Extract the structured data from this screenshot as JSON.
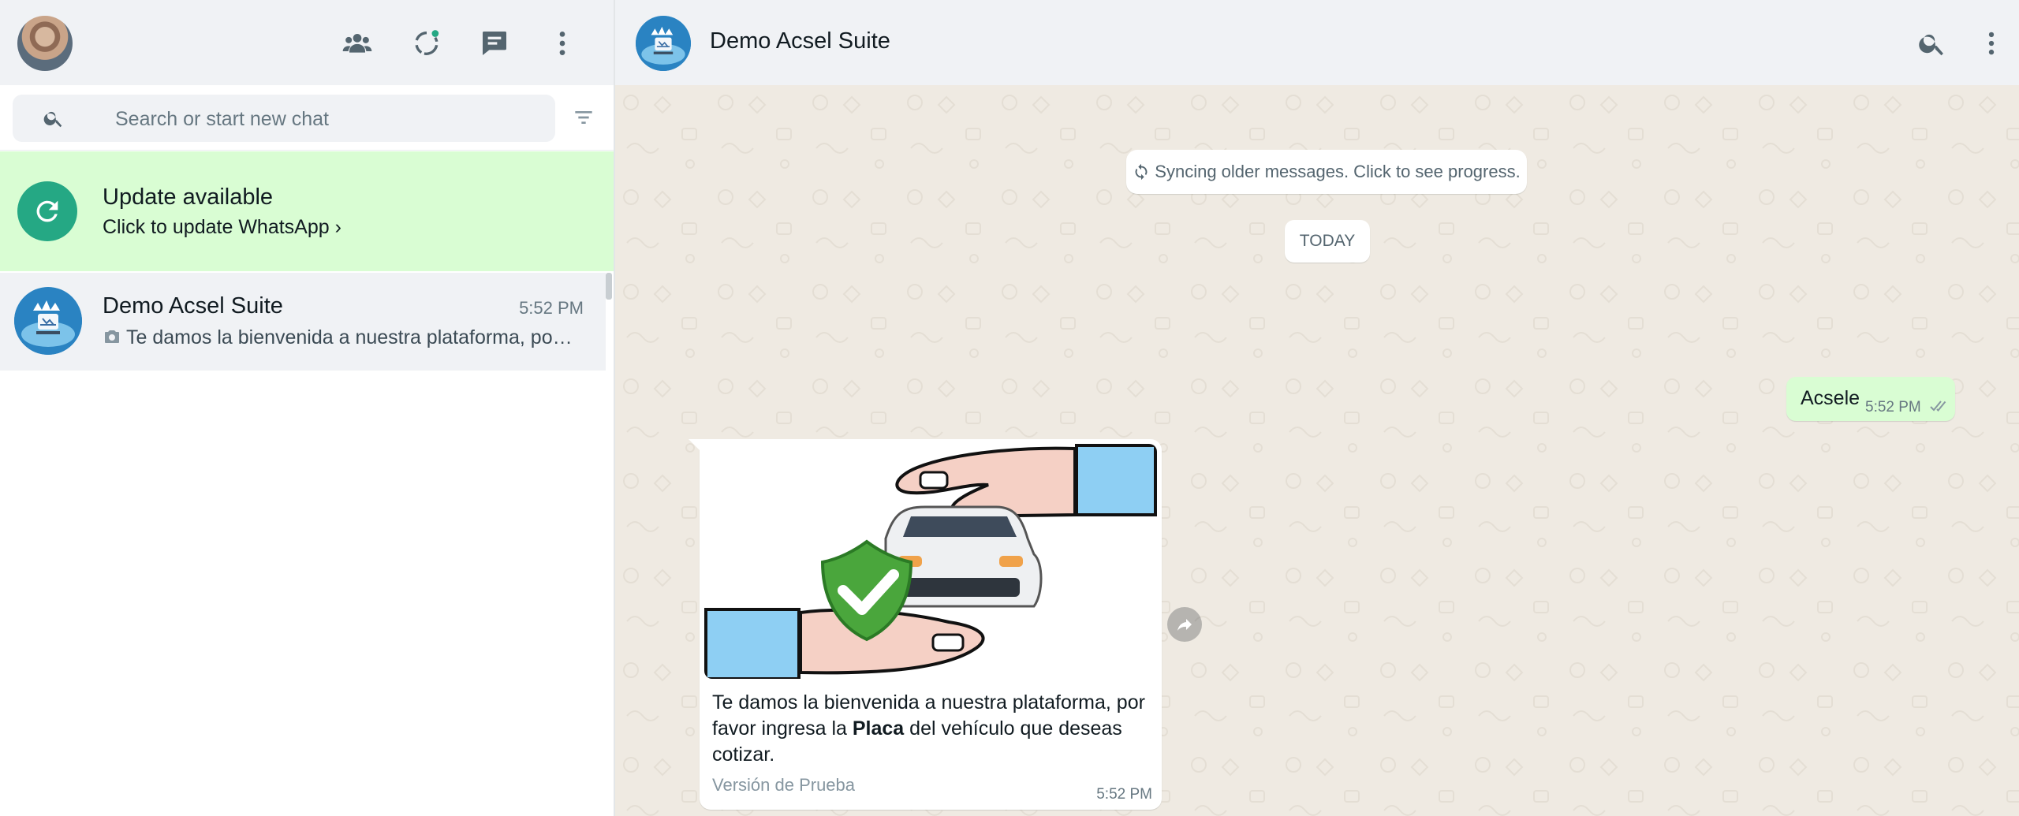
{
  "sidebar": {
    "header": {
      "profile_avatar": "user-photo",
      "icons": [
        "communities-icon",
        "status-icon",
        "new-chat-icon",
        "menu-icon"
      ]
    },
    "search": {
      "placeholder": "Search or start new chat",
      "value": ""
    },
    "update_banner": {
      "title": "Update available",
      "subtitle": "Click to update WhatsApp ›"
    },
    "chats": [
      {
        "name": "Demo Acsel Suite",
        "time": "5:52 PM",
        "preview": "Te damos la bienvenida a nuestra plataforma, por f..."
      }
    ]
  },
  "conversation": {
    "contact_name": "Demo Acsel Suite",
    "sync_notice": "Syncing older messages. Click to see progress.",
    "date_divider": "TODAY",
    "messages": [
      {
        "direction": "outgoing",
        "text": "Acsele",
        "time": "5:52 PM",
        "status": "delivered"
      },
      {
        "direction": "incoming",
        "type": "image",
        "caption_before": "Te damos la bienvenida a nuestra plataforma, por favor ingresa la ",
        "caption_bold": "Placa",
        "caption_after": " del vehículo que deseas cotizar.",
        "footer": "Versión de Prueba",
        "time": "5:52 PM"
      }
    ]
  },
  "colors": {
    "header_bg": "#f0f2f5",
    "chat_bg": "#efeae2",
    "outgoing_bubble": "#d9fdd3",
    "banner_bg": "#d9fdd3",
    "accent": "#25a884"
  }
}
